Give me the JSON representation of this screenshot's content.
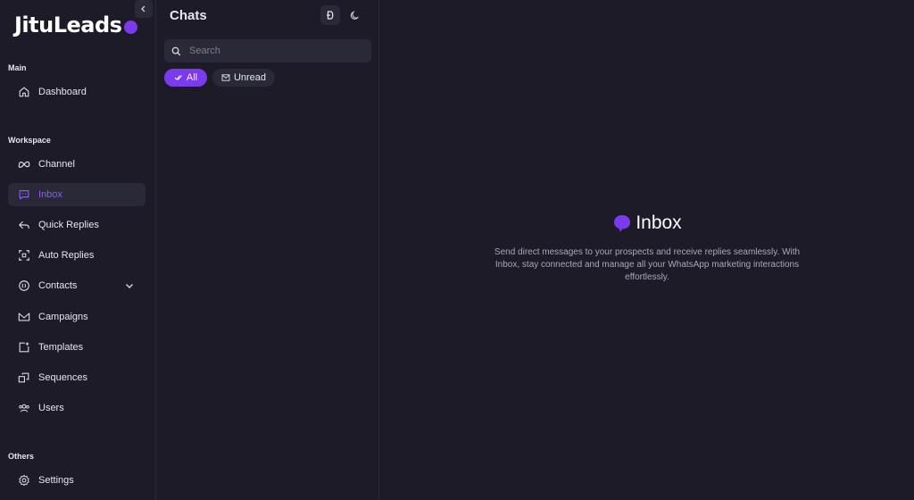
{
  "brand": {
    "name": "JituLeads",
    "accent": "#7c3aed"
  },
  "sidebar": {
    "sections": {
      "main": "Main",
      "workspace": "Workspace",
      "others": "Others"
    },
    "items": [
      {
        "label": "Dashboard",
        "icon": "home-icon"
      },
      {
        "label": "Channel",
        "icon": "meta-icon"
      },
      {
        "label": "Inbox",
        "icon": "message-icon",
        "active": true
      },
      {
        "label": "Quick Replies",
        "icon": "reply-icon"
      },
      {
        "label": "Auto Replies",
        "icon": "scan-icon"
      },
      {
        "label": "Contacts",
        "icon": "contact-icon"
      },
      {
        "label": "Campaigns",
        "icon": "mail-icon"
      },
      {
        "label": "Templates",
        "icon": "template-icon"
      },
      {
        "label": "Sequences",
        "icon": "sequence-icon"
      },
      {
        "label": "Users",
        "icon": "users-icon"
      },
      {
        "label": "Settings",
        "icon": "gear-icon"
      }
    ]
  },
  "chats": {
    "title": "Chats",
    "search_placeholder": "Search",
    "filters": {
      "all": "All",
      "unread": "Unread"
    }
  },
  "main": {
    "empty_title": "Inbox",
    "empty_desc": "Send direct messages to your prospects and receive replies seamlessly. With Inbox, stay connected and manage all your WhatsApp marketing interactions effortlessly."
  }
}
